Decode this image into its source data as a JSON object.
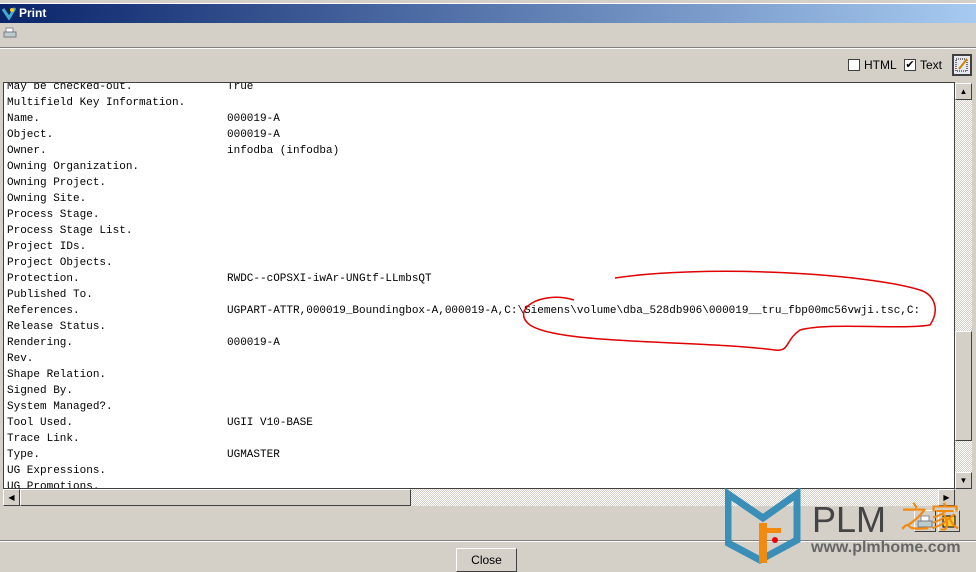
{
  "window": {
    "title": "Print"
  },
  "options": {
    "html_label": "HTML",
    "html_checked": false,
    "text_label": "Text",
    "text_checked": true
  },
  "rows": [
    {
      "label": "May be checked-out.",
      "value": "True"
    },
    {
      "label": "Multifield Key Information.",
      "value": ""
    },
    {
      "label": "Name.",
      "value": "000019-A"
    },
    {
      "label": "Object.",
      "value": "000019-A"
    },
    {
      "label": "Owner.",
      "value": "infodba (infodba)"
    },
    {
      "label": "Owning Organization.",
      "value": ""
    },
    {
      "label": "Owning Project.",
      "value": ""
    },
    {
      "label": "Owning Site.",
      "value": ""
    },
    {
      "label": "Process Stage.",
      "value": ""
    },
    {
      "label": "Process Stage List.",
      "value": ""
    },
    {
      "label": "Project IDs.",
      "value": ""
    },
    {
      "label": "Project Objects.",
      "value": ""
    },
    {
      "label": "Protection.",
      "value": "RWDC--cOPSXI-iwAr-UNGtf-LLmbsQT"
    },
    {
      "label": "Published To.",
      "value": ""
    },
    {
      "label": "References.",
      "value": "UGPART-ATTR,000019_Boundingbox-A,000019-A,C:\\Siemens\\volume\\dba_528db906\\000019__tru_fbp00mc56vwji.tsc,C:"
    },
    {
      "label": "Release Status.",
      "value": ""
    },
    {
      "label": "Rendering.",
      "value": "000019-A"
    },
    {
      "label": "Rev.",
      "value": ""
    },
    {
      "label": "Shape Relation.",
      "value": ""
    },
    {
      "label": "Signed By.",
      "value": ""
    },
    {
      "label": "System Managed?.",
      "value": ""
    },
    {
      "label": "Tool Used.",
      "value": "UGII V10-BASE"
    },
    {
      "label": "Trace Link.",
      "value": ""
    },
    {
      "label": "Type.",
      "value": "UGMASTER"
    },
    {
      "label": "UG Expressions.",
      "value": ""
    },
    {
      "label": "UG Promotions.",
      "value": ""
    }
  ],
  "footer": {
    "close_label": "Close"
  },
  "watermark": {
    "brand": "PLM之家",
    "url": "www.plmhome.com"
  },
  "colors": {
    "annotation": "#e00000",
    "titlebar": "#0a246a"
  }
}
